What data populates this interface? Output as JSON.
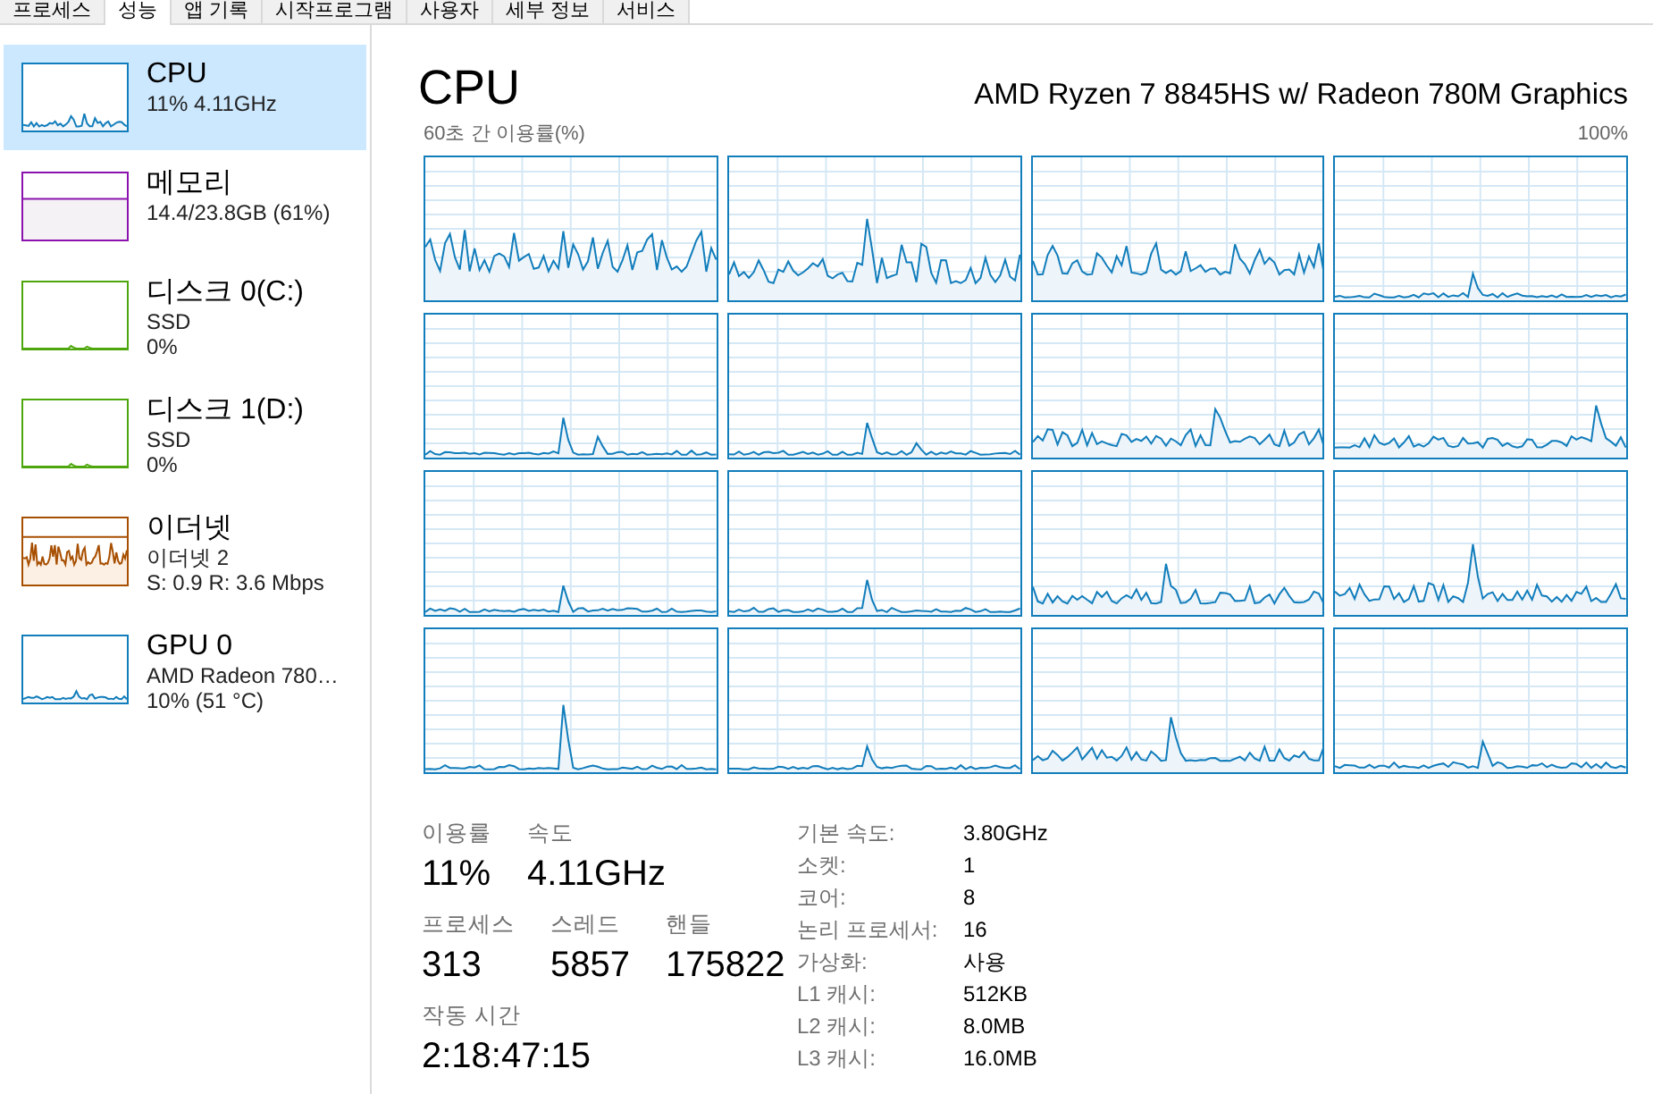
{
  "tabs": [
    {
      "label": "프로세스",
      "selected": false
    },
    {
      "label": "성능",
      "selected": true
    },
    {
      "label": "앱 기록",
      "selected": false
    },
    {
      "label": "시작프로그램",
      "selected": false
    },
    {
      "label": "사용자",
      "selected": false
    },
    {
      "label": "세부 정보",
      "selected": false
    },
    {
      "label": "서비스",
      "selected": false
    }
  ],
  "sidebar": {
    "items": [
      {
        "kind": "cpu",
        "title": "CPU",
        "lines": [
          "11% 4.11GHz"
        ],
        "color": "#117dbb",
        "selected": true
      },
      {
        "kind": "memory",
        "title": "메모리",
        "lines": [
          "14.4/23.8GB (61%)"
        ],
        "color": "#8b12ae",
        "selected": false
      },
      {
        "kind": "disk",
        "title": "디스크 0(C:)",
        "lines": [
          "SSD",
          "0%"
        ],
        "color": "#4da60c",
        "selected": false
      },
      {
        "kind": "disk",
        "title": "디스크 1(D:)",
        "lines": [
          "SSD",
          "0%"
        ],
        "color": "#4da60c",
        "selected": false
      },
      {
        "kind": "ethernet",
        "title": "이더넷",
        "lines": [
          "이더넷 2",
          "S: 0.9 R: 3.6 Mbps"
        ],
        "color": "#a74f01",
        "selected": false
      },
      {
        "kind": "gpu",
        "title": "GPU 0",
        "lines": [
          "AMD Radeon 780…",
          "10% (51 °C)"
        ],
        "color": "#117dbb",
        "selected": false
      }
    ]
  },
  "cpu_panel": {
    "title": "CPU",
    "model": "AMD Ryzen 7 8845HS w/ Radeon 780M Graphics",
    "graph_caption": "60초 간 이용률(%)",
    "graph_max": "100%",
    "stats": [
      [
        {
          "label": "이용률",
          "value": "11%"
        },
        {
          "label": "속도",
          "value": "4.11GHz"
        }
      ],
      [
        {
          "label": "프로세스",
          "value": "313"
        },
        {
          "label": "스레드",
          "value": "5857"
        },
        {
          "label": "핸들",
          "value": "175822"
        }
      ],
      [
        {
          "label": "작동 시간",
          "value": "2:18:47:15"
        }
      ]
    ],
    "details": [
      {
        "label": "기본 속도:",
        "value": "3.80GHz"
      },
      {
        "label": "소켓:",
        "value": "1"
      },
      {
        "label": "코어:",
        "value": "8"
      },
      {
        "label": "논리 프로세서:",
        "value": "16"
      },
      {
        "label": "가상화:",
        "value": "사용"
      },
      {
        "label": "L1 캐시:",
        "value": "512KB"
      },
      {
        "label": "L2 캐시:",
        "value": "8.0MB"
      },
      {
        "label": "L3 캐시:",
        "value": "16.0MB"
      }
    ]
  }
}
